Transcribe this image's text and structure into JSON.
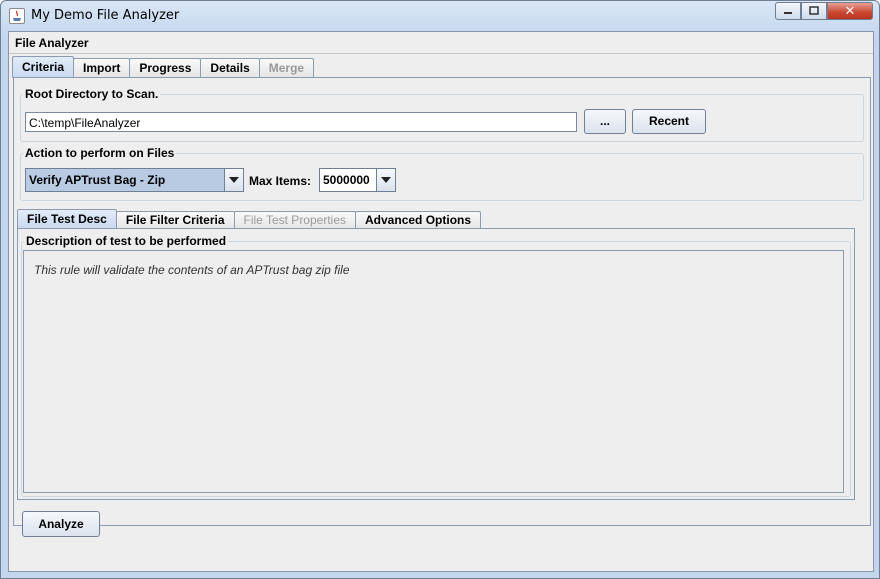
{
  "window": {
    "title": "My Demo File Analyzer",
    "close_label": "✕"
  },
  "frame": {
    "title": "File Analyzer"
  },
  "main_tabs": [
    {
      "label": "Criteria",
      "state": "active"
    },
    {
      "label": "Import",
      "state": "normal"
    },
    {
      "label": "Progress",
      "state": "normal"
    },
    {
      "label": "Details",
      "state": "normal"
    },
    {
      "label": "Merge",
      "state": "disabled"
    }
  ],
  "root_dir": {
    "legend": "Root Directory to Scan.",
    "value": "C:\\temp\\FileAnalyzer",
    "browse_label": "...",
    "recent_label": "Recent"
  },
  "action": {
    "legend": "Action to perform on Files",
    "selected": "Verify APTrust Bag - Zip",
    "max_items_label": "Max Items:",
    "max_items_value": "5000000"
  },
  "sub_tabs": [
    {
      "label": "File Test Desc",
      "state": "active"
    },
    {
      "label": "File Filter Criteria",
      "state": "normal"
    },
    {
      "label": "File Test Properties",
      "state": "disabled"
    },
    {
      "label": "Advanced Options",
      "state": "normal"
    }
  ],
  "description": {
    "legend": "Description of test to be performed",
    "text": "This rule will validate the contents of an APTrust bag zip file"
  },
  "analyze_label": "Analyze"
}
